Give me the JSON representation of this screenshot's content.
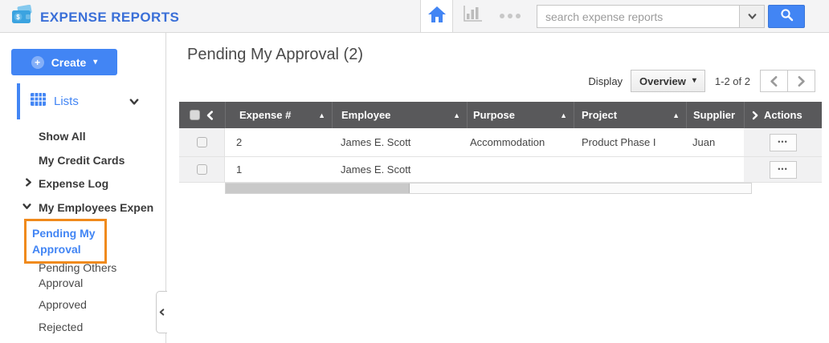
{
  "app": {
    "title": "EXPENSE REPORTS",
    "search": {
      "placeholder": "search expense reports"
    }
  },
  "sidebar": {
    "create_label": "Create",
    "lists_label": "Lists",
    "items": [
      {
        "label": "Show All"
      },
      {
        "label": "My Credit Cards"
      },
      {
        "label": "Expense Log"
      },
      {
        "label": "My Employees Expen"
      },
      {
        "label": "Pending My Approval"
      },
      {
        "label": "Pending Others Approval"
      },
      {
        "label": "Approved"
      },
      {
        "label": "Rejected"
      }
    ]
  },
  "main": {
    "title": "Pending My Approval (2)",
    "display_label": "Display",
    "display_value": "Overview",
    "range_text": "1-2 of 2"
  },
  "table": {
    "columns": [
      "Expense #",
      "Employee",
      "Purpose",
      "Project",
      "Supplier",
      "Actions"
    ],
    "rows": [
      {
        "expense": "2",
        "employee": "James E. Scott",
        "purpose": "Accommodation",
        "project": "Product Phase I",
        "supplier": "Juan"
      },
      {
        "expense": "1",
        "employee": "James E. Scott",
        "purpose": "",
        "project": "",
        "supplier": ""
      }
    ]
  },
  "icons": {
    "plus": "+",
    "caret_down": "▾",
    "sort_asc": "▲",
    "ellipsis": "•••"
  },
  "colors": {
    "accent_blue": "#4285f4",
    "brand_blue": "#3a6fd8",
    "table_header_gray": "#59595b",
    "highlight_orange": "#f08a1c"
  }
}
